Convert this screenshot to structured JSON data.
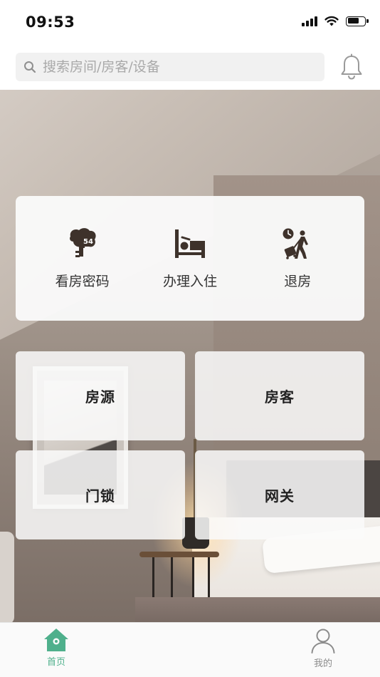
{
  "status_bar": {
    "time": "09:53"
  },
  "search": {
    "placeholder": "搜索房间/房客/设备",
    "value": ""
  },
  "quick_actions": [
    {
      "label": "看房密码",
      "icon": "key-icon",
      "badge": "54"
    },
    {
      "label": "办理入住",
      "icon": "bed-icon"
    },
    {
      "label": "退房",
      "icon": "checkout-icon"
    }
  ],
  "tiles": [
    {
      "label": "房源"
    },
    {
      "label": "房客"
    },
    {
      "label": "门锁"
    },
    {
      "label": "网关"
    }
  ],
  "tabbar": [
    {
      "label": "首页",
      "icon": "home-icon",
      "active": true
    },
    {
      "label": "我的",
      "icon": "user-icon",
      "active": false
    }
  ],
  "colors": {
    "accent": "#4fb08c",
    "icon_dark": "#3e322b",
    "tab_inactive": "#8c8c8c"
  }
}
